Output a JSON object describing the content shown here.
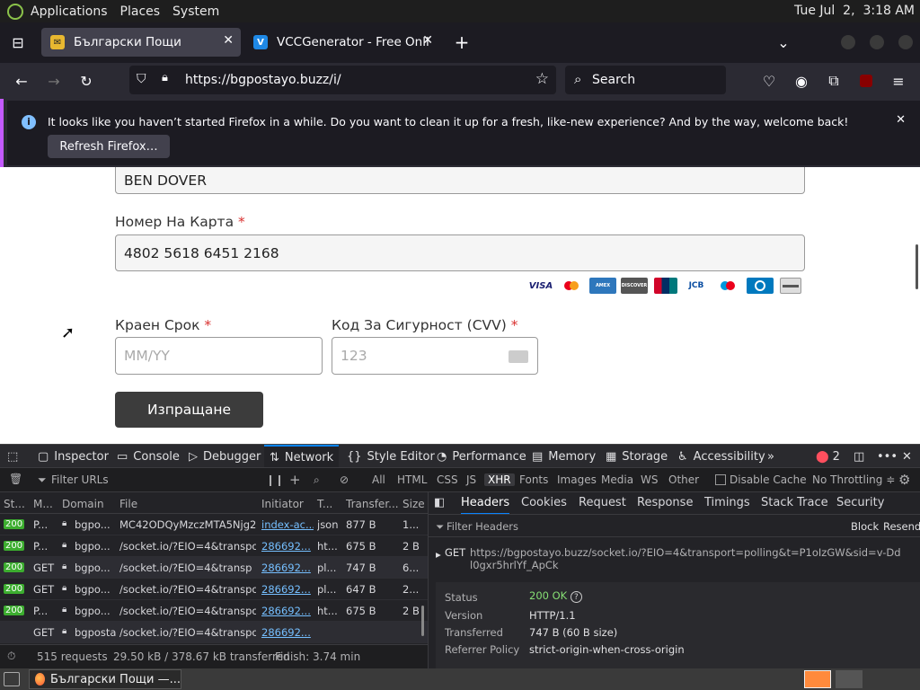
{
  "system": {
    "menus": [
      "Applications",
      "Places",
      "System"
    ],
    "clock": "Tue Jul  2,  3:18 AM"
  },
  "tabs": [
    {
      "title": "Български Пощи",
      "active": true
    },
    {
      "title": "VCCGenerator - Free Online",
      "active": false
    }
  ],
  "nav": {
    "url": "https://bgpostayo.buzz/i/",
    "search_placeholder": "Search"
  },
  "notification": {
    "message": "It looks like you haven’t started Firefox in a while. Do you want to clean it up for a fresh, like-new experience? And by the way, welcome back!",
    "button": "Refresh Firefox…"
  },
  "form": {
    "name_value": "BEN DOVER",
    "card_label": "Номер На Карта",
    "card_value": "4802 5618 6451 2168",
    "card_brands": [
      "VISA",
      "Mastercard",
      "American Express",
      "DISCOVER",
      "UnionPay",
      "JCB",
      "Maestro",
      "Diners Club",
      "Generic card"
    ],
    "expiry_label": "Краен Срок",
    "expiry_placeholder": "MM/YY",
    "cvv_label": "Код За Сигурност (CVV)",
    "cvv_placeholder": "123",
    "required_mark": "*",
    "submit": "Изпращане"
  },
  "devtools": {
    "tabs": [
      "Inspector",
      "Console",
      "Debugger",
      "Network",
      "Style Editor",
      "Performance",
      "Memory",
      "Storage",
      "Accessibility"
    ],
    "error_count": "2",
    "filter_placeholder": "Filter URLs",
    "type_filters": [
      "All",
      "HTML",
      "CSS",
      "JS",
      "XHR",
      "Fonts",
      "Images",
      "Media",
      "WS",
      "Other"
    ],
    "disable_cache": "Disable Cache",
    "throttling": "No Throttling ≑",
    "columns": [
      "St...",
      "M...",
      "Domain",
      "File",
      "Initiator",
      "T...",
      "Transfer...",
      "Size"
    ],
    "rows": [
      {
        "status": "200",
        "method": "P...",
        "domain": "bgpo...",
        "file": "MC42ODQyMzczMTA5Njg2OD",
        "initiator": "index-ac...",
        "type": "json",
        "transferred": "877 B",
        "size": "1..."
      },
      {
        "status": "200",
        "method": "P...",
        "domain": "bgpo...",
        "file": "/socket.io/?EIO=4&transport=p",
        "initiator": "286692...",
        "type": "ht...",
        "transferred": "675 B",
        "size": "2 B"
      },
      {
        "status": "200",
        "method": "GET",
        "domain": "bgpo...",
        "file": "/socket.io/?EIO=4&transp",
        "initiator": "286692...",
        "type": "pl...",
        "transferred": "747 B",
        "size": "6..."
      },
      {
        "status": "200",
        "method": "GET",
        "domain": "bgpo...",
        "file": "/socket.io/?EIO=4&transport=p",
        "initiator": "286692...",
        "type": "pl...",
        "transferred": "647 B",
        "size": "2..."
      },
      {
        "status": "200",
        "method": "P...",
        "domain": "bgpo...",
        "file": "/socket.io/?EIO=4&transport=p",
        "initiator": "286692...",
        "type": "ht...",
        "transferred": "675 B",
        "size": "2 B"
      },
      {
        "status": "",
        "method": "GET",
        "domain": "bgposta...",
        "file": "/socket.io/?EIO=4&transport=p",
        "initiator": "286692...",
        "type": "",
        "transferred": "",
        "size": ""
      }
    ],
    "footer": {
      "requests": "515 requests",
      "transferred": "29.50 kB / 378.67 kB transferred",
      "finish": "Finish: 3.74 min"
    },
    "side_tabs": [
      "Headers",
      "Cookies",
      "Request",
      "Response",
      "Timings",
      "Stack Trace",
      "Security"
    ],
    "filter_headers": "Filter Headers",
    "block": "Block",
    "resend": "Resend",
    "request_method": "GET",
    "request_url": "https://bgpostayo.buzz/socket.io/?EIO=4&transport=polling&t=P1oIzGW&sid=v-Ddl0gxr5hrlYf_ApCk",
    "fields": [
      {
        "key": "Status",
        "value": "200 OK"
      },
      {
        "key": "Version",
        "value": "HTTP/1.1"
      },
      {
        "key": "Transferred",
        "value": "747 B (60 B size)"
      },
      {
        "key": "Referrer Policy",
        "value": "strict-origin-when-cross-origin"
      }
    ]
  },
  "taskbar": {
    "window": "Български Пощи —..."
  },
  "colors": {
    "accent": "#0a84ff",
    "status_ok": "#3cad2f",
    "firefox_bg": "#1c1b22",
    "notification_border": "#c45aff",
    "submit_bg": "#3c3c3c"
  }
}
